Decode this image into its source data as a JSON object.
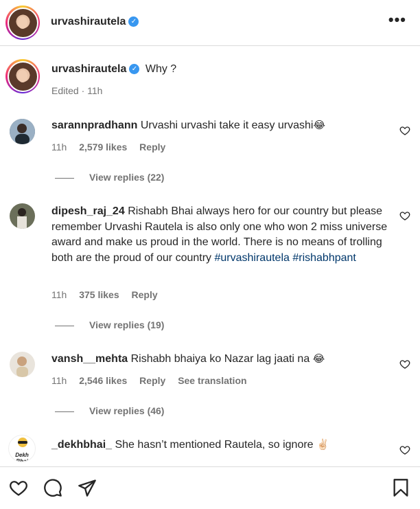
{
  "header": {
    "username": "urvashirautela",
    "more_label": "•••"
  },
  "caption": {
    "username": "urvashirautela",
    "text": "Why ?",
    "edited": "Edited · 11h"
  },
  "comments": [
    {
      "username": "sarannpradhann",
      "text": "Urvashi urvashi take it easy urvashi",
      "emoji": "😂",
      "time": "11h",
      "likes": "2,579 likes",
      "reply": "Reply",
      "view_replies": "View replies (22)"
    },
    {
      "username": "dipesh_raj_24",
      "text": "Rishabh Bhai always hero for our country but please remember Urvashi Rautela is also only one who won 2 miss universe award and make us proud in the world. There is no means of trolling both are the proud of our country",
      "tags": "#urvashirautela #rishabhpant",
      "time": "11h",
      "likes": "375 likes",
      "reply": "Reply",
      "view_replies": "View replies (19)"
    },
    {
      "username": "vansh__mehta",
      "text": "Rishabh bhaiya ko Nazar lag jaati na",
      "emoji": "😂",
      "time": "11h",
      "likes": "2,546 likes",
      "reply": "Reply",
      "translate": "See translation",
      "view_replies": "View replies (46)"
    },
    {
      "username": "_dekhbhai_",
      "text": "She hasn’t mentioned Rautela, so ignore",
      "emoji": "✌🏻",
      "avatar_text": "Dekh Bhai"
    }
  ],
  "icons": {
    "like": "heart-icon",
    "comment": "comment-icon",
    "share": "share-icon",
    "save": "bookmark-icon"
  },
  "colors": {
    "verified": "#3897f0",
    "hashtag": "#00376b",
    "muted": "#737373"
  }
}
